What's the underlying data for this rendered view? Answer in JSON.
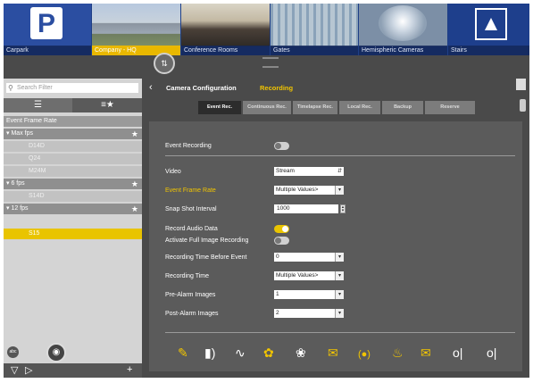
{
  "categories": [
    {
      "label": "Carpark",
      "icon": "parking-icon",
      "selected": false
    },
    {
      "label": "Company - HQ",
      "icon": "building-icon",
      "selected": true
    },
    {
      "label": "Conference Rooms",
      "icon": "people-icon",
      "selected": false
    },
    {
      "label": "Gates",
      "icon": "gate-icon",
      "selected": false
    },
    {
      "label": "Hemispheric Cameras",
      "icon": "dome-camera-icon",
      "selected": false
    },
    {
      "label": "Stairs",
      "icon": "stairs-icon",
      "selected": false
    }
  ],
  "sidebar": {
    "filter_placeholder": "Search Filter",
    "tree": {
      "header": "Event Frame Rate",
      "groups": [
        {
          "label": "Max fps",
          "items": [
            "D14D",
            "Q24",
            "M24M"
          ]
        },
        {
          "label": "6 fps",
          "items": [
            "S14D"
          ]
        },
        {
          "label": "12 fps",
          "items": []
        }
      ],
      "selected_item": "S15"
    },
    "abc_label": "abc"
  },
  "header": {
    "title": "Camera Configuration",
    "subtitle": "Recording"
  },
  "tabs": [
    "Event Rec.",
    "Continuous Rec.",
    "Timelapse Rec.",
    "Local Rec.",
    "Backup",
    "Reserve"
  ],
  "form": {
    "event_recording_label": "Event Recording",
    "event_recording_on": false,
    "video_label": "Video",
    "video_value": "Stream",
    "event_frame_rate_label": "Event Frame Rate",
    "event_frame_rate_value": "Multiple Values>",
    "snapshot_interval_label": "Snap Shot Interval",
    "snapshot_interval_value": "1000",
    "record_audio_label": "Record Audio Data",
    "record_audio_on": true,
    "full_image_label": "Activate Full Image Recording",
    "full_image_on": false,
    "time_before_label": "Recording Time Before Event",
    "time_before_value": "0",
    "recording_time_label": "Recording Time",
    "recording_time_value": "Multiple Values>",
    "pre_alarm_label": "Pre-Alarm Images",
    "pre_alarm_value": "1",
    "post_alarm_label": "Post-Alarm Images",
    "post_alarm_value": "2"
  },
  "icons": [
    "pencil-icon",
    "camera-audio-icon",
    "signal-icon",
    "motion-person-icon",
    "running-person-icon",
    "mail-icon",
    "radio-wave-icon",
    "bell-icon",
    "mail-icon",
    "toggle-in-icon",
    "toggle-out-icon"
  ],
  "colors": {
    "accent": "#e9c400",
    "banner": "#1f3f86",
    "panel": "#5b5b5b"
  }
}
